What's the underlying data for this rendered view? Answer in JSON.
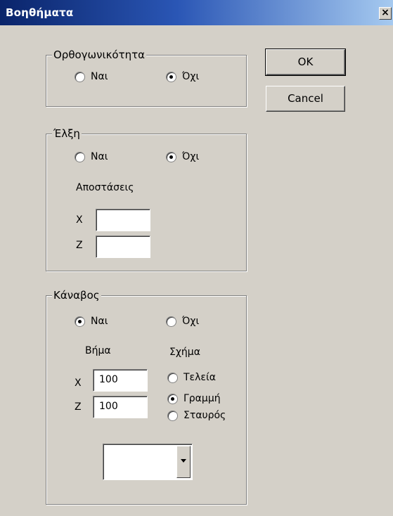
{
  "window": {
    "title": "Βοηθήματα",
    "close_label": "×"
  },
  "buttons": {
    "ok": "OK",
    "cancel": "Cancel"
  },
  "orthogonality": {
    "legend": "Ορθογωνικότητα",
    "yes": "Ναι",
    "no": "Όχι",
    "selected": "no"
  },
  "attraction": {
    "legend": "Έλξη",
    "yes": "Ναι",
    "no": "Όχι",
    "selected": "no",
    "distances_label": "Αποστάσεις",
    "x_label": "X",
    "x_value": "",
    "z_label": "Z",
    "z_value": ""
  },
  "grid": {
    "legend": "Κάναβος",
    "yes": "Ναι",
    "no": "Όχι",
    "selected": "yes",
    "step_label": "Βήμα",
    "shape_label": "Σχήμα",
    "x_label": "X",
    "x_value": "100",
    "z_label": "Z",
    "z_value": "100",
    "shape_options": [
      "Τελεία",
      "Γραμμή",
      "Σταυρός"
    ],
    "shape_selected": "Γραμμή",
    "dropdown_value": ""
  }
}
